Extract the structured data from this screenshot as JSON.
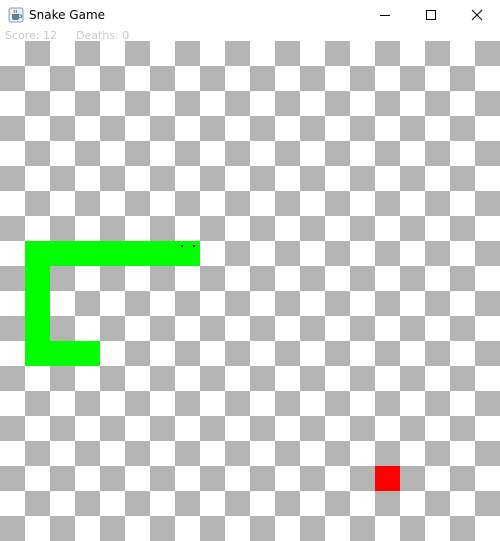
{
  "window": {
    "title": "Snake Game",
    "icons": {
      "app": "java-cup-icon",
      "minimize": "minimize-icon",
      "maximize": "maximize-icon",
      "close": "close-icon"
    }
  },
  "hud": {
    "score_text": "Score: 12",
    "deaths_text": "Deaths: 0"
  },
  "game": {
    "grid_cols": 20,
    "grid_rows": 20,
    "checker_color": "#b4b4b4",
    "background_color": "#ffffff",
    "snake_color": "#00ff00",
    "eye_color": "#000000",
    "food_color": "#ff0000",
    "direction": "right",
    "snake_cells": [
      [
        7,
        8
      ],
      [
        6,
        8
      ],
      [
        5,
        8
      ],
      [
        4,
        8
      ],
      [
        3,
        8
      ],
      [
        2,
        8
      ],
      [
        1,
        8
      ],
      [
        1,
        9
      ],
      [
        1,
        10
      ],
      [
        1,
        11
      ],
      [
        1,
        12
      ],
      [
        2,
        12
      ],
      [
        3,
        12
      ]
    ],
    "food_cell": [
      15,
      17
    ]
  }
}
